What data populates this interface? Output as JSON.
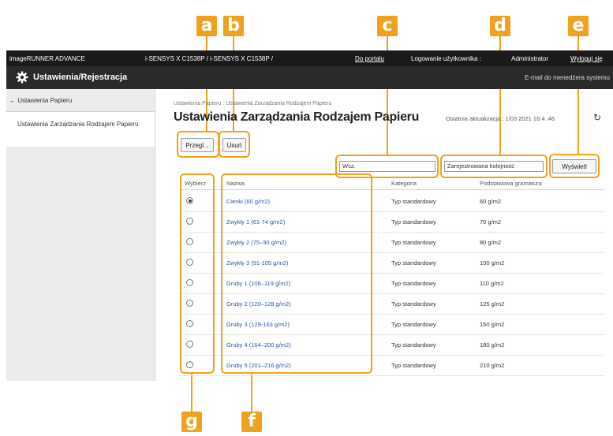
{
  "callouts": [
    "a",
    "b",
    "c",
    "d",
    "e",
    "g",
    "f"
  ],
  "topbar": {
    "product": "imageRUNNER ADVANCE",
    "models": "i-SENSYS X C1538P / i-SENSYS X C1538P /",
    "portal_link": "Do portalu",
    "login_label": "Logowanie użytkownika :",
    "user": "Administrator",
    "logout": "Wyloguj się"
  },
  "titlebar": {
    "title": "Ustawienia/Rejestracja",
    "email_admin": "E-mail do menedżera systemu"
  },
  "sidebar": {
    "back": "← Ustawienia Papieru",
    "item": "Ustawienia Zarządzania Rodzajem Papieru"
  },
  "main": {
    "breadcrumb": "Ustawienia Papieru : Ustawienia Zarządzania Rodzajem Papieru",
    "title": "Ustawienia Zarządzania Rodzajem Papieru",
    "last_update": "Ostatnia aktualizacja : 1/03 2021 16:4 :46"
  },
  "toolbar": {
    "details_label": "Przegl...",
    "delete_label": "Usuń",
    "search_value": "Wsz.",
    "sort_value": "Zarejestrowana kolejność",
    "display_label": "Wyświetl"
  },
  "table": {
    "headers": [
      "Wybierz",
      "Nazwa",
      "Kategoria",
      "Podstawowa gramatura"
    ],
    "rows": [
      {
        "name": "Cienki (60 g/m2)",
        "category": "Typ standardowy",
        "weight": "60 g/m2",
        "selected": true
      },
      {
        "name": "Zwykły 1 (61-74 g/m2)",
        "category": "Typ standardowy",
        "weight": "70 g/m2",
        "selected": false
      },
      {
        "name": "Zwykły 2 (75–90 g/m2)",
        "category": "Typ standardowy",
        "weight": "80 g/m2",
        "selected": false
      },
      {
        "name": "Zwykły 3 (91-105 g/m2)",
        "category": "Typ standardowy",
        "weight": "100 g/m2",
        "selected": false
      },
      {
        "name": "Gruby 1 (106–119 g/m2)",
        "category": "Typ standardowy",
        "weight": "110 g/m2",
        "selected": false
      },
      {
        "name": "Gruby 2 (120–128 g/m2)",
        "category": "Typ standardowy",
        "weight": "125 g/m2",
        "selected": false
      },
      {
        "name": "Gruby 3 (129-163 g/m2)",
        "category": "Typ standardowy",
        "weight": "150 g/m2",
        "selected": false
      },
      {
        "name": "Gruby 4 (164–200 g/m2)",
        "category": "Typ standardowy",
        "weight": "180 g/m2",
        "selected": false
      },
      {
        "name": "Gruby 5 (201–216 g/m2)",
        "category": "Typ standardowy",
        "weight": "210 g/m2",
        "selected": false
      }
    ]
  },
  "colors": {
    "callout": "#f0a21c",
    "link": "#2a58a8",
    "header": "#1a1a1a"
  }
}
